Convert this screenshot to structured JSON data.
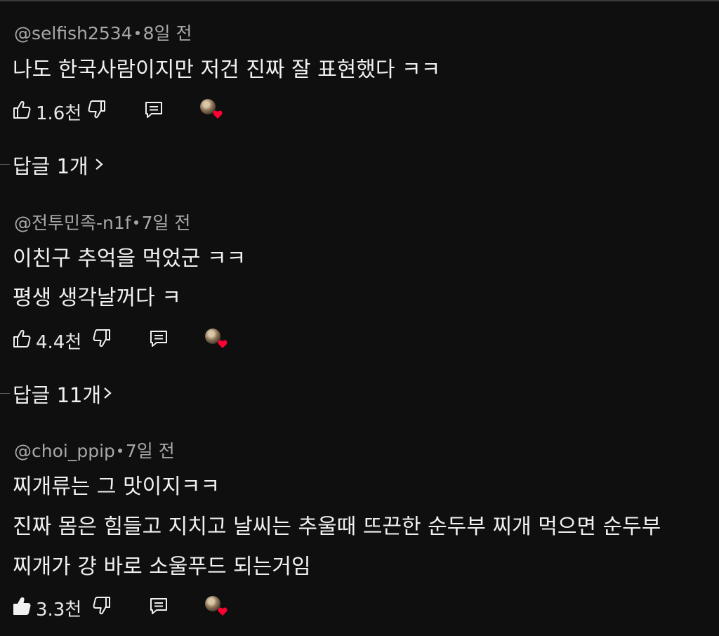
{
  "comments": [
    {
      "author": "@selfish2534",
      "time": "8일 전",
      "lines": [
        "나도 한국사람이지만 저건 진짜 잘 표현했다 ㅋㅋ"
      ],
      "likes": "1.6천",
      "replies_label": "답글 1개"
    },
    {
      "author": "@전투민족-n1f",
      "time": "7일 전",
      "lines": [
        "이친구 추억을 먹었군 ㅋㅋ",
        "평생 생각날꺼다 ㅋ"
      ],
      "likes": "4.4천",
      "replies_label": "답글 11개"
    },
    {
      "author": "@choi_ppip",
      "time": "7일 전",
      "lines": [
        "찌개류는 그 맛이지ㅋㅋ",
        "진짜 몸은 힘들고 지치고 날씨는 추울때 뜨끈한 순두부 찌개 먹으면 순두부",
        "찌개가 걍 바로 소울푸드 되는거임"
      ],
      "likes": "3.3천",
      "liked": true
    }
  ],
  "icons": {
    "like": "thumbs-up-icon",
    "dislike": "thumbs-down-icon",
    "reply": "comment-icon",
    "creator_heart": "heart-icon",
    "replies_chevron": "chevron-right-icon"
  },
  "colors": {
    "background": "#0f0f0f",
    "text": "#f1f1f1",
    "meta": "#a8a8a8",
    "heart": "#ff0033"
  }
}
